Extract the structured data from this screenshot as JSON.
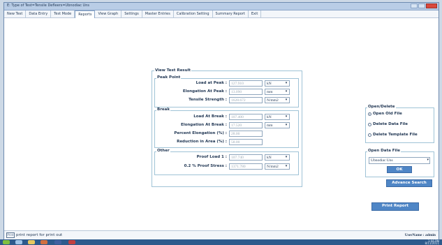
{
  "window": {
    "title": "E: Type of Test=Tensile     Defleers=Ubnodiac Uns"
  },
  "menu": {
    "tabs": [
      {
        "label": "New Test"
      },
      {
        "label": "Data Entry"
      },
      {
        "label": "Test Mode"
      },
      {
        "label": "Reports",
        "active": true
      },
      {
        "label": "View Graph"
      },
      {
        "label": "Settings"
      },
      {
        "label": "Master Entries"
      },
      {
        "label": "Calibration Setting"
      },
      {
        "label": "Summary Report"
      },
      {
        "label": "Exit"
      }
    ]
  },
  "result_panel": {
    "legend": "View Test Result",
    "peak": {
      "legend": "Peak Point",
      "rows": [
        {
          "label": "Load at Peak :",
          "value": "127.910",
          "unit": "kN"
        },
        {
          "label": "Elongation At Peak :",
          "value": "13.090",
          "unit": "mm"
        },
        {
          "label": "Tensile Strength :",
          "value": "1628.672",
          "unit": "N/mm2"
        }
      ]
    },
    "break": {
      "legend": "Break",
      "rows": [
        {
          "label": "Load At Break :",
          "value": "107.400",
          "unit": "kN"
        },
        {
          "label": "Elongation At Break :",
          "value": "17.520",
          "unit": "mm"
        },
        {
          "label": "Percent Elongation (%) :",
          "value": "28.00",
          "unit": ""
        },
        {
          "label": "Reduction in Area (%) :",
          "value": "58.00",
          "unit": ""
        }
      ]
    },
    "other": {
      "legend": "Other",
      "rows": [
        {
          "label": "Proof Load 1 :",
          "value": "107.740",
          "unit": "kN"
        },
        {
          "label": "0.2 % Proof Stress :",
          "value": "1371.780",
          "unit": "N/mm2"
        }
      ]
    }
  },
  "open_delete": {
    "legend": "Open/Delete",
    "options": [
      {
        "label": "Open Old File",
        "selected": true
      },
      {
        "label": "Delete Data File",
        "selected": false
      },
      {
        "label": "Delete Template File",
        "selected": false
      }
    ]
  },
  "open_data_file": {
    "legend": "Open Data File",
    "selected": "Ubnodiac Uns",
    "ok_label": "OK"
  },
  "buttons": {
    "advance_search": "Advance Search",
    "print_report": "Print Report"
  },
  "status": {
    "left_badge": "Print",
    "left_text": "print report for print out",
    "right_text": "UserName : admin"
  },
  "taskbar": {
    "time": "1:06 PM",
    "date": "8/11/2011"
  },
  "colors": {
    "accent": "#4f86c6",
    "panel_border": "#9fc3d6",
    "text": "#1f3552",
    "close": "#d9483b"
  }
}
